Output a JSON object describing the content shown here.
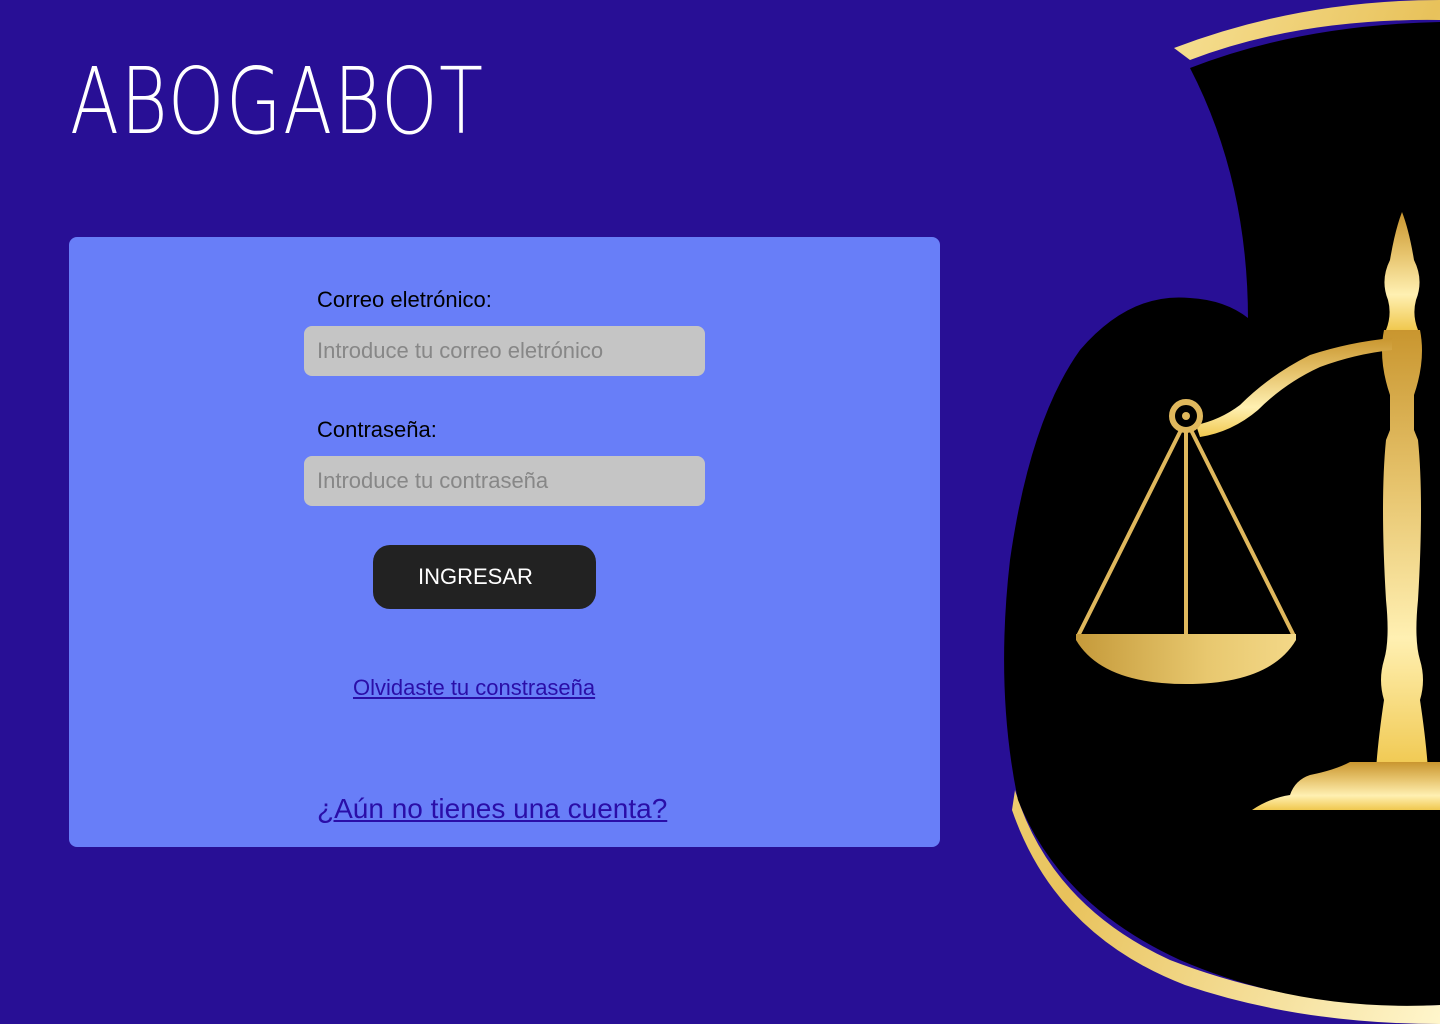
{
  "brand": {
    "name": "ABOGABOT"
  },
  "form": {
    "email_label": "Correo eletrónico:",
    "email_placeholder": "Introduce tu correo eletrónico",
    "email_value": "",
    "password_label": "Contraseña:",
    "password_placeholder": "Introduce tu contraseña",
    "password_value": "",
    "submit_label": "INGRESAR",
    "forgot_link": "Olvidaste tu constraseña",
    "signup_link": "¿Aún no tienes una cuenta?"
  },
  "theme": {
    "background": "#280f95",
    "card": "#687ef8",
    "input": "#c5c5c5",
    "button": "#222222",
    "link": "#2a0ea8",
    "gold": "#e0b85d"
  },
  "illustration": {
    "icon": "scales-of-justice-icon"
  }
}
